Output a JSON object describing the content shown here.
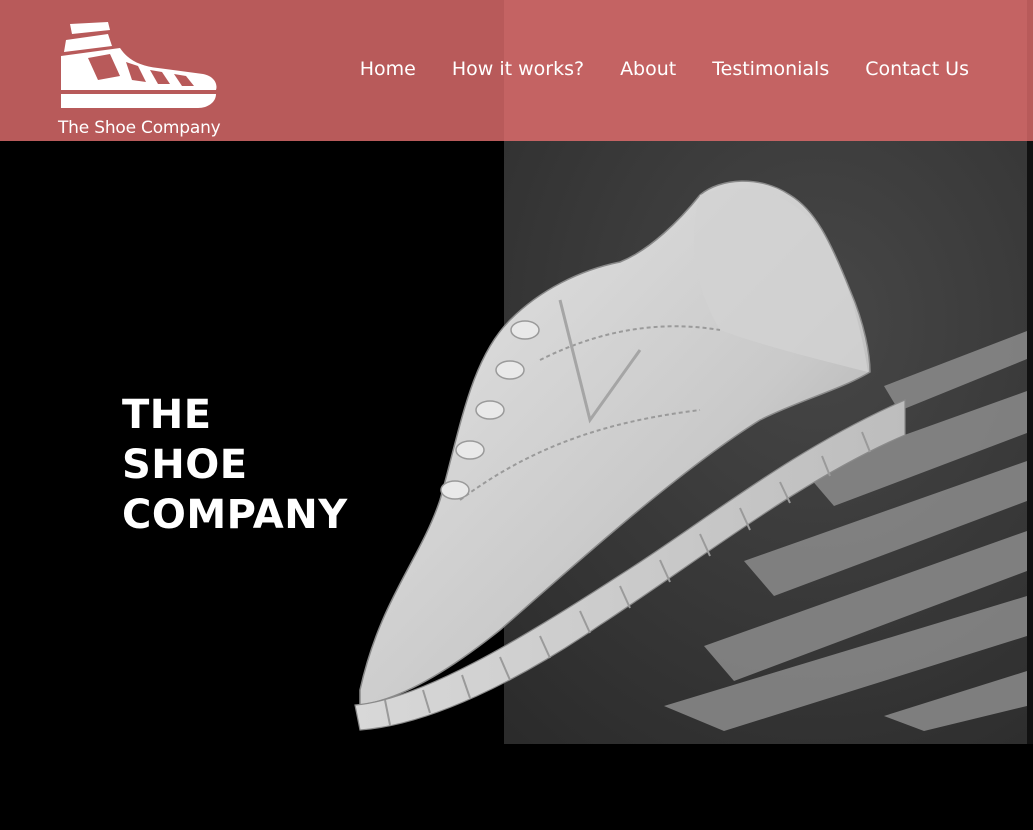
{
  "brand": {
    "name": "The Shoe Company",
    "logo_icon": "sneaker-icon",
    "colors": {
      "nav_background": "#b85a5a",
      "page_background": "#000000",
      "text": "#ffffff"
    }
  },
  "nav": {
    "items": [
      {
        "label": "Home"
      },
      {
        "label": "How it works?"
      },
      {
        "label": "About"
      },
      {
        "label": "Testimonials"
      },
      {
        "label": "Contact Us"
      }
    ]
  },
  "hero": {
    "title_lines": [
      "THE",
      "SHOE",
      "COMPANY"
    ],
    "image": "white-sneaker-on-crosswalk"
  }
}
